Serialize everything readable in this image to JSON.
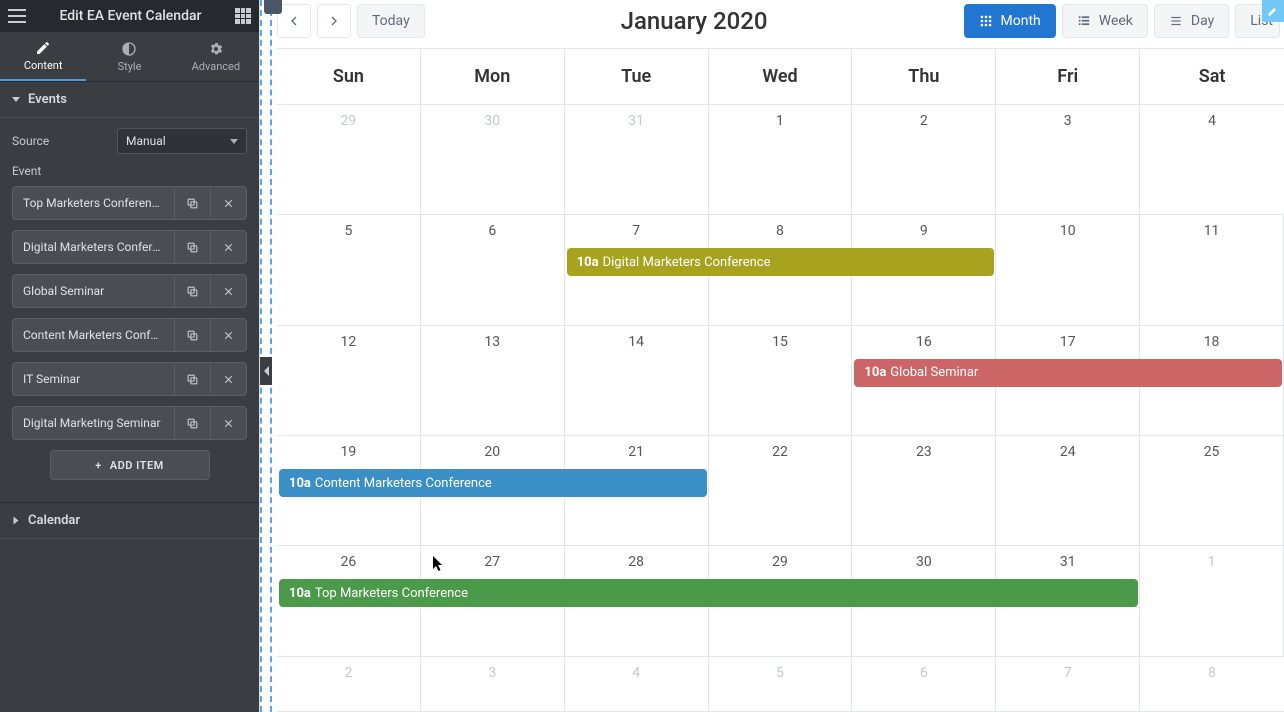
{
  "sidebar": {
    "title": "Edit EA Event Calendar",
    "tabs": [
      {
        "label": "Content"
      },
      {
        "label": "Style"
      },
      {
        "label": "Advanced"
      }
    ],
    "sections": {
      "events": "Events",
      "calendar": "Calendar"
    },
    "source_label": "Source",
    "source_value": "Manual",
    "event_label": "Event",
    "events": [
      {
        "name": "Top Marketers Conference"
      },
      {
        "name": "Digital Marketers Confere…"
      },
      {
        "name": "Global Seminar"
      },
      {
        "name": "Content Marketers Confe…"
      },
      {
        "name": "IT Seminar"
      },
      {
        "name": "Digital Marketing Seminar"
      }
    ],
    "add_item": "ADD ITEM"
  },
  "calendar": {
    "title": "January 2020",
    "nav": {
      "today": "Today"
    },
    "views": {
      "month": "Month",
      "week": "Week",
      "day": "Day",
      "list": "List"
    },
    "dow": [
      "Sun",
      "Mon",
      "Tue",
      "Wed",
      "Thu",
      "Fri",
      "Sat"
    ],
    "weeks": [
      [
        {
          "n": "29",
          "o": true
        },
        {
          "n": "30",
          "o": true
        },
        {
          "n": "31",
          "o": true
        },
        {
          "n": "1"
        },
        {
          "n": "2"
        },
        {
          "n": "3"
        },
        {
          "n": "4"
        }
      ],
      [
        {
          "n": "5"
        },
        {
          "n": "6"
        },
        {
          "n": "7"
        },
        {
          "n": "8"
        },
        {
          "n": "9"
        },
        {
          "n": "10"
        },
        {
          "n": "11"
        }
      ],
      [
        {
          "n": "12"
        },
        {
          "n": "13"
        },
        {
          "n": "14"
        },
        {
          "n": "15"
        },
        {
          "n": "16"
        },
        {
          "n": "17"
        },
        {
          "n": "18"
        }
      ],
      [
        {
          "n": "19"
        },
        {
          "n": "20"
        },
        {
          "n": "21"
        },
        {
          "n": "22"
        },
        {
          "n": "23"
        },
        {
          "n": "24"
        },
        {
          "n": "25"
        }
      ],
      [
        {
          "n": "26"
        },
        {
          "n": "27"
        },
        {
          "n": "28"
        },
        {
          "n": "29"
        },
        {
          "n": "30"
        },
        {
          "n": "31"
        },
        {
          "n": "1",
          "o": true
        }
      ],
      [
        {
          "n": "2",
          "o": true
        },
        {
          "n": "3",
          "o": true
        },
        {
          "n": "4",
          "o": true
        },
        {
          "n": "5",
          "o": true
        },
        {
          "n": "6",
          "o": true
        },
        {
          "n": "7",
          "o": true
        },
        {
          "n": "8",
          "o": true
        }
      ]
    ],
    "events": [
      {
        "week": 1,
        "start": 2,
        "span": 3,
        "time": "10a",
        "title": "Digital Marketers Conference",
        "color": "#a8a31f"
      },
      {
        "week": 2,
        "start": 4,
        "span": 3,
        "time": "10a",
        "title": "Global Seminar",
        "color": "#c66"
      },
      {
        "week": 3,
        "start": 0,
        "span": 3,
        "time": "10a",
        "title": "Content Marketers Conference",
        "color": "#3a8fc7"
      },
      {
        "week": 4,
        "start": 0,
        "span": 6,
        "time": "10a",
        "title": "Top Marketers Conference",
        "color": "#4a9a4a"
      }
    ]
  }
}
